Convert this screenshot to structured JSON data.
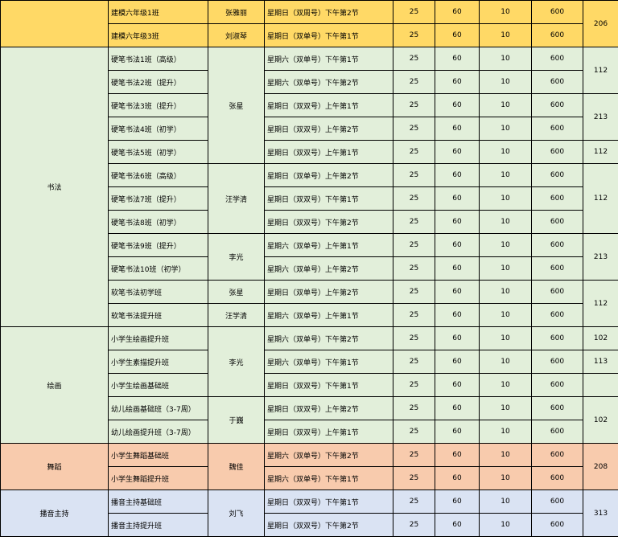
{
  "subjects": [
    {
      "name": "",
      "color": "#ffd966",
      "teachers": [
        {
          "name": "张雅丽",
          "rows": 1
        },
        {
          "name": "刘淑琴",
          "rows": 1
        }
      ],
      "rooms": [
        {
          "value": "206",
          "rows": 2
        }
      ],
      "rows": [
        {
          "class": "建模六年级1班",
          "time": "星期日（双周号）下午第2节",
          "c1": "25",
          "c2": "60",
          "c3": "10",
          "c4": "600"
        },
        {
          "class": "建模六年级3班",
          "time": "星期日（双单号）下午第1节",
          "c1": "25",
          "c2": "60",
          "c3": "10",
          "c4": "600"
        }
      ]
    },
    {
      "name": "书法",
      "color": "#e2efda",
      "teachers": [
        {
          "name": "张星",
          "rows": 5
        },
        {
          "name": "汪学清",
          "rows": 3
        },
        {
          "name": "李光",
          "rows": 2
        },
        {
          "name": "张星",
          "rows": 1
        },
        {
          "name": "汪学清",
          "rows": 1
        }
      ],
      "rooms": [
        {
          "value": "112",
          "rows": 2
        },
        {
          "value": "213",
          "rows": 2
        },
        {
          "value": "112",
          "rows": 1
        },
        {
          "value": "112",
          "rows": 3
        },
        {
          "value": "213",
          "rows": 2
        },
        {
          "value": "112",
          "rows": 2
        }
      ],
      "rows": [
        {
          "class": "硬笔书法1班（高级）",
          "time": "星期六（双单号）下午第1节",
          "c1": "25",
          "c2": "60",
          "c3": "10",
          "c4": "600"
        },
        {
          "class": "硬笔书法2班（提升）",
          "time": "星期六（双单号）下午第2节",
          "c1": "25",
          "c2": "60",
          "c3": "10",
          "c4": "600"
        },
        {
          "class": "硬笔书法3班（提升）",
          "time": "星期日（双双号）上午第1节",
          "c1": "25",
          "c2": "60",
          "c3": "10",
          "c4": "600"
        },
        {
          "class": "硬笔书法4班（初学）",
          "time": "星期日（双双号）上午第2节",
          "c1": "25",
          "c2": "60",
          "c3": "10",
          "c4": "600"
        },
        {
          "class": "硬笔书法5班（初学）",
          "time": "星期日（双双号）上午第1节",
          "c1": "25",
          "c2": "60",
          "c3": "10",
          "c4": "600"
        },
        {
          "class": "硬笔书法6班（高级）",
          "time": "星期日（双单号）上午第2节",
          "c1": "25",
          "c2": "60",
          "c3": "10",
          "c4": "600"
        },
        {
          "class": "硬笔书法7班（提升）",
          "time": "星期日（双双号）下午第1节",
          "c1": "25",
          "c2": "60",
          "c3": "10",
          "c4": "600"
        },
        {
          "class": "硬笔书法8班（初学）",
          "time": "星期日（双双号）下午第2节",
          "c1": "25",
          "c2": "60",
          "c3": "10",
          "c4": "600"
        },
        {
          "class": "硬笔书法9班（提升）",
          "time": "星期六（双单号）上午第1节",
          "c1": "25",
          "c2": "60",
          "c3": "10",
          "c4": "600"
        },
        {
          "class": "硬笔书法10班（初学）",
          "time": "星期六（双单号）上午第2节",
          "c1": "25",
          "c2": "60",
          "c3": "10",
          "c4": "600"
        },
        {
          "class": "软笔书法初学班",
          "time": "星期日（双单号）上午第2节",
          "c1": "25",
          "c2": "60",
          "c3": "10",
          "c4": "600"
        },
        {
          "class": "软笔书法提升班",
          "time": "星期六（双单号）上午第1节",
          "c1": "25",
          "c2": "60",
          "c3": "10",
          "c4": "600"
        }
      ]
    },
    {
      "name": "绘画",
      "color": "#e2efda",
      "teachers": [
        {
          "name": "李光",
          "rows": 3
        },
        {
          "name": "于巍",
          "rows": 2
        }
      ],
      "rooms": [
        {
          "value": "102",
          "rows": 1
        },
        {
          "value": "113",
          "rows": 1
        },
        {
          "value": "",
          "rows": 1
        },
        {
          "value": "102",
          "rows": 2
        }
      ],
      "rows": [
        {
          "class": "小学生绘画提升班",
          "time": "星期六（双单号）下午第2节",
          "c1": "25",
          "c2": "60",
          "c3": "10",
          "c4": "600"
        },
        {
          "class": "小学生素描提升班",
          "time": "星期六（双单号）下午第1节",
          "c1": "25",
          "c2": "60",
          "c3": "10",
          "c4": "600"
        },
        {
          "class": "小学生绘画基础班",
          "time": "星期日（双双号）下午第1节",
          "c1": "25",
          "c2": "60",
          "c3": "10",
          "c4": "600"
        },
        {
          "class": "幼儿绘画基础班（3-7周）",
          "time": "星期日（双双号）上午第2节",
          "c1": "25",
          "c2": "60",
          "c3": "10",
          "c4": "600"
        },
        {
          "class": "幼儿绘画提升班（3-7周）",
          "time": "星期日（双双号）上午第1节",
          "c1": "25",
          "c2": "60",
          "c3": "10",
          "c4": "600"
        }
      ]
    },
    {
      "name": "舞蹈",
      "color": "#f8cbad",
      "teachers": [
        {
          "name": "魏佳",
          "rows": 2
        }
      ],
      "rooms": [
        {
          "value": "208",
          "rows": 2
        }
      ],
      "rows": [
        {
          "class": "小学生舞蹈基础班",
          "time": "星期六（双单号）下午第2节",
          "c1": "25",
          "c2": "60",
          "c3": "10",
          "c4": "600"
        },
        {
          "class": "小学生舞蹈提升班",
          "time": "星期六（双单号）下午第1节",
          "c1": "25",
          "c2": "60",
          "c3": "10",
          "c4": "600"
        }
      ]
    },
    {
      "name": "播音主持",
      "color": "#dae3f3",
      "teachers": [
        {
          "name": "刘飞",
          "rows": 2
        }
      ],
      "rooms": [
        {
          "value": "313",
          "rows": 2
        }
      ],
      "rows": [
        {
          "class": "播音主持基础班",
          "time": "星期日（双双号）下午第1节",
          "c1": "25",
          "c2": "60",
          "c3": "10",
          "c4": "600"
        },
        {
          "class": "播音主持提升班",
          "time": "星期日（双双号）下午第2节",
          "c1": "25",
          "c2": "60",
          "c3": "10",
          "c4": "600"
        }
      ]
    }
  ]
}
